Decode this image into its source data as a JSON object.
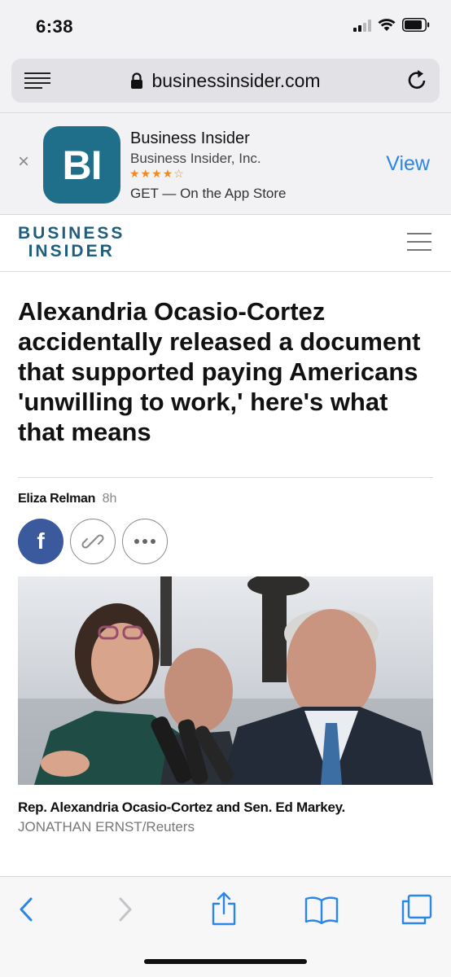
{
  "status": {
    "time": "6:38",
    "icons": [
      "signal-icon",
      "wifi-icon",
      "battery-icon"
    ]
  },
  "browser": {
    "url": "businessinsider.com",
    "icons": [
      "reader-icon",
      "lock-icon",
      "reload-icon"
    ]
  },
  "app_banner": {
    "close": "×",
    "icon_text": "BI",
    "name": "Business Insider",
    "company": "Business Insider, Inc.",
    "rating_stars": "★★★★☆",
    "rating": 4.5,
    "get_text": "GET — On the App Store",
    "view_label": "View"
  },
  "site": {
    "logo_line1": "BUSINESS",
    "logo_line2": "INSIDER",
    "menu_icon": "hamburger-menu-icon"
  },
  "article": {
    "headline": "Alexandria Ocasio-Cortez accidentally released a document that supported paying Americans 'unwilling to work,' here's what that means",
    "author": "Eliza Relman",
    "time": "8h",
    "share": {
      "facebook": "f",
      "icons": [
        "facebook-icon",
        "link-icon",
        "more-icon"
      ]
    },
    "photo_caption": "Rep. Alexandria Ocasio-Cortez and Sen. Ed Markey.",
    "photo_credit": "JONATHAN ERNST/Reuters"
  },
  "toolbar": {
    "icons": [
      "back-icon",
      "forward-icon",
      "share-icon",
      "bookmarks-icon",
      "tabs-icon"
    ]
  },
  "colors": {
    "brand": "#1f5e7e",
    "app_icon": "#1f6f8b",
    "link_blue": "#2a86e8",
    "facebook": "#3b5a9e",
    "star": "#f28b1e"
  }
}
